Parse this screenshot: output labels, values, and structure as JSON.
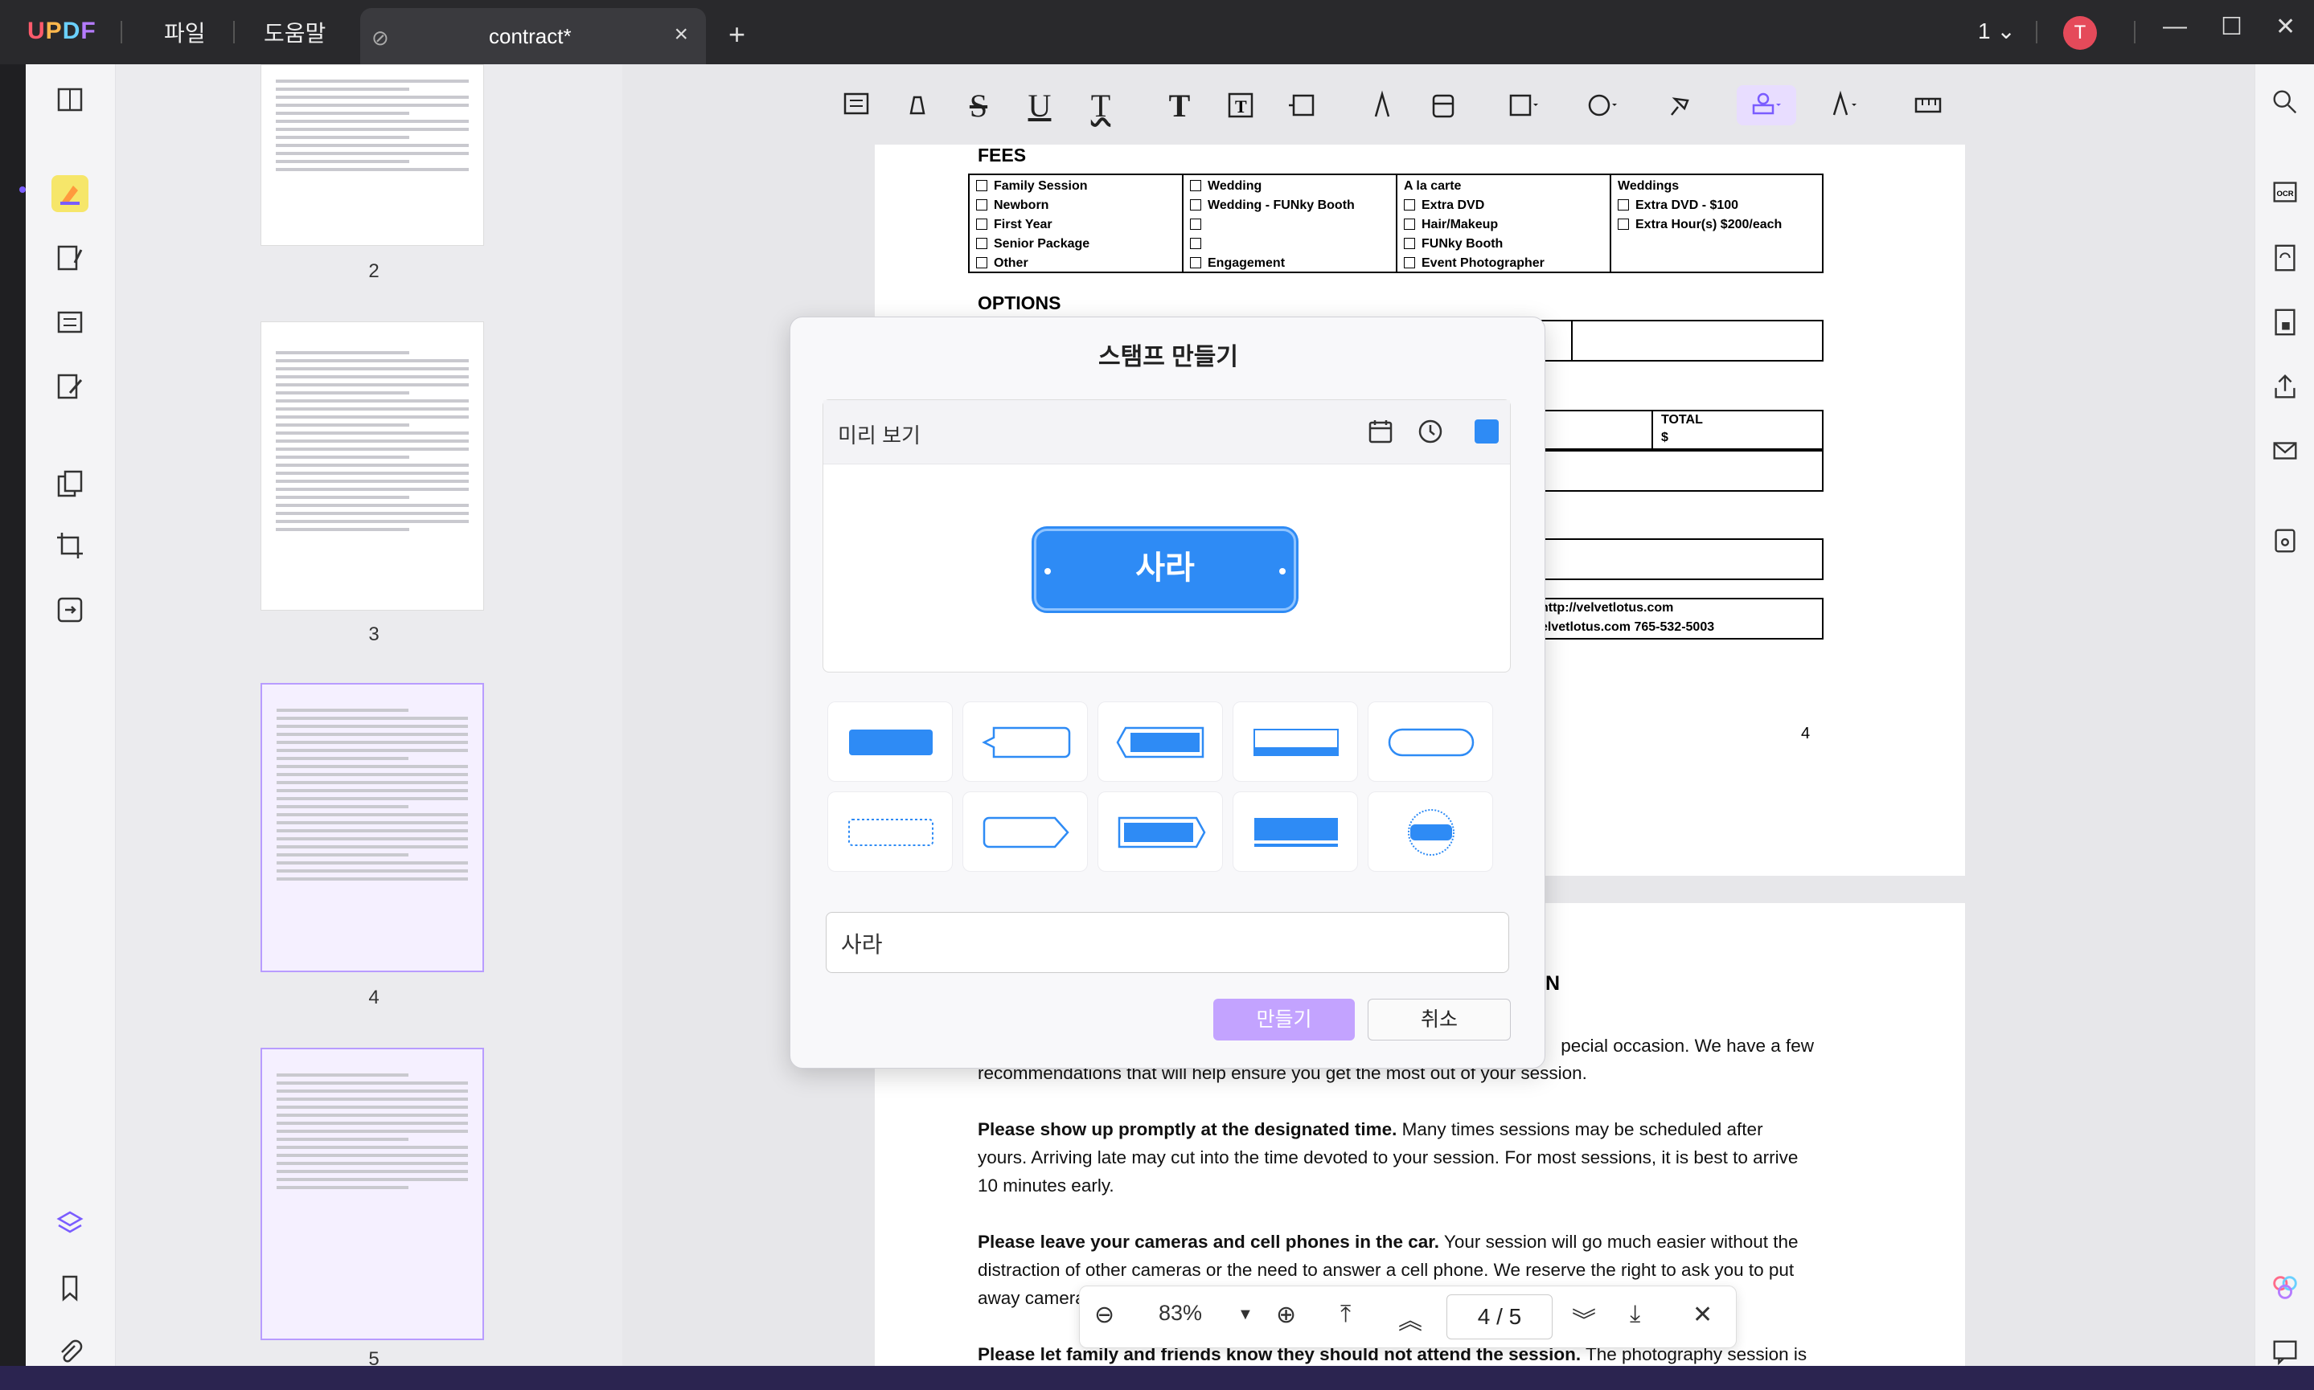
{
  "titlebar": {
    "logo": [
      "U",
      "P",
      "D",
      "F"
    ],
    "menu_file": "파일",
    "menu_help": "도움말",
    "tab_label": "contract*",
    "page_selector": "1",
    "avatar_initial": "T"
  },
  "thumbnails": {
    "labels": [
      "2",
      "3",
      "4",
      "5"
    ]
  },
  "document": {
    "fees_heading": "FEES",
    "fees_cols": [
      [
        "Family Session",
        "Newborn",
        "First Year",
        "Senior Package",
        "Other"
      ],
      [
        "Wedding",
        "Wedding - FUNky Booth",
        "",
        "",
        "Engagement"
      ],
      [
        "A la carte",
        "Extra DVD",
        "Hair/Makeup",
        "FUNky Booth",
        "Event Photographer"
      ],
      [
        "Weddings",
        "Extra DVD - $100",
        "Extra Hour(s) $200/each"
      ]
    ],
    "options_heading": "OPTIONS",
    "total_label": "TOTAL",
    "total_value": "$",
    "contact_line1": "http://velvetlotus.com",
    "contact_line2": "elvetlotus.com 765-532-5003",
    "page_number": "4",
    "section_heading_tail": "N",
    "para0_tail": "pecial occasion. We have a few",
    "para0_line2": "recommendations that will help ensure you get the most out of your session.",
    "para1_bold": "Please show up promptly at the designated time.",
    "para1_rest": " Many times sessions may be scheduled after yours. Arriving late may cut into the time devoted to your session. For most sessions, it is best to arrive 10 minutes early.",
    "para2_bold": "Please leave your cameras and cell phones in the car.",
    "para2_rest": " Your session will go much easier without the distraction of other cameras or the need to answer a cell phone. We reserve the right to ask you to put away camera",
    "para3_bold": "Please let family and friends know they should not attend the session.",
    "para3_rest": " The photography session is"
  },
  "dialog": {
    "title": "스탬프 만들기",
    "preview_label": "미리 보기",
    "stamp_text": "사라",
    "stamp_color": "#2e8bf5",
    "input_value": "사라",
    "create_button": "만들기",
    "cancel_button": "취소"
  },
  "bottom_bar": {
    "zoom": "83%",
    "page_current": "4",
    "page_total": "5"
  },
  "colors": {
    "accent": "#7a5cff",
    "stamp_blue": "#2e8bf5",
    "create_button": "#c3a3ff"
  }
}
